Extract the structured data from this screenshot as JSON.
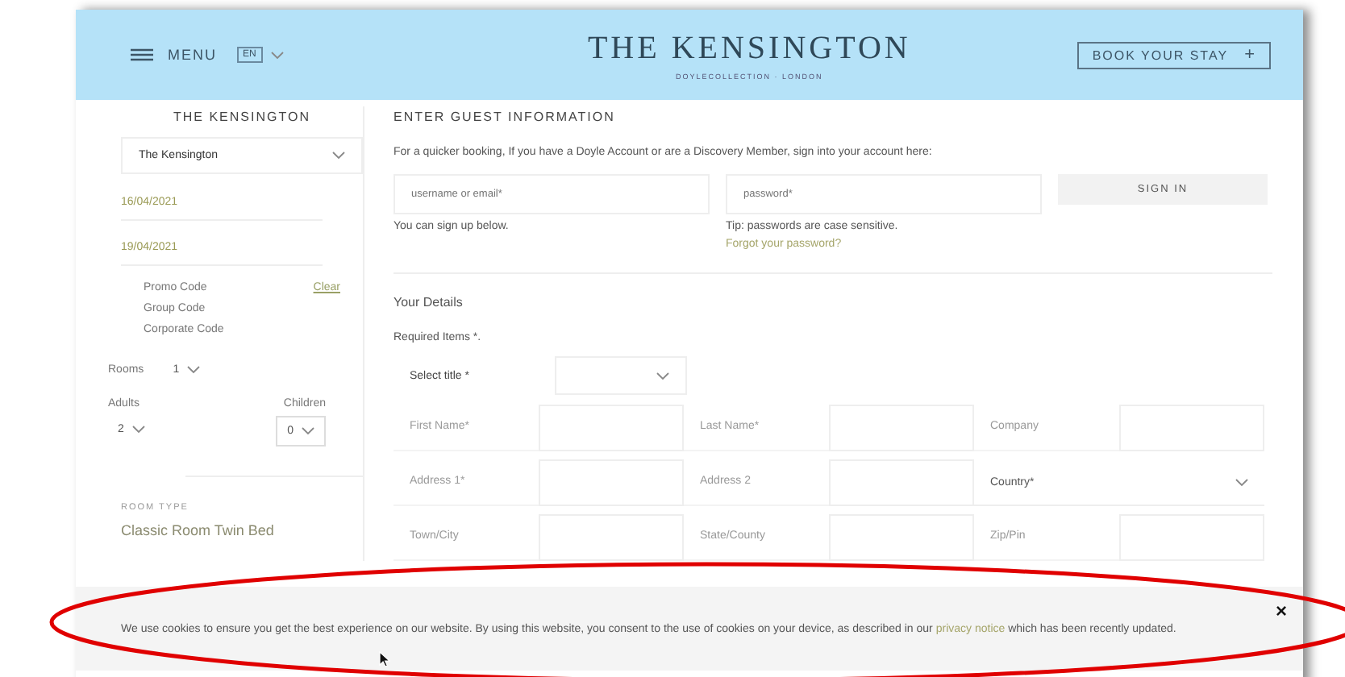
{
  "header": {
    "menu_label": "MENU",
    "language": "EN",
    "logo_title": "THE KENSINGTON",
    "logo_subtitle": "DOYLECOLLECTION · LONDON",
    "book_button": "BOOK YOUR STAY",
    "book_icon": "+"
  },
  "sidebar": {
    "title": "THE KENSINGTON",
    "hotel": "The Kensington",
    "arrival": "16/04/2021",
    "departure": "19/04/2021",
    "codes": [
      "Promo Code",
      "Group Code",
      "Corporate Code"
    ],
    "clear_link": "Clear",
    "rooms": {
      "label": "Rooms",
      "value": "1"
    },
    "adults": {
      "label": "Adults",
      "value": "2"
    },
    "children": {
      "label": "Children",
      "value": "0"
    },
    "room_type_label": "ROOM TYPE",
    "room_type": "Classic Room Twin Bed"
  },
  "main": {
    "heading": "ENTER GUEST INFORMATION",
    "intro": "For a quicker booking, If you have a Doyle Account or are a Discovery Member, sign into your account here:",
    "username": {
      "placeholder": "username or email*"
    },
    "password": {
      "placeholder": "password*"
    },
    "sign_in_button": "SIGN IN",
    "signup_note": "You can sign up below.",
    "password_tip": "Tip: passwords are case sensitive.",
    "forgot_link": "Forgot your password?",
    "details_heading": "Your Details",
    "required_note": "Required Items *.",
    "title_select": {
      "label": "Select title *"
    },
    "fields": [
      {
        "label": "First Name*",
        "kind": "input"
      },
      {
        "label": "Last Name*",
        "kind": "input"
      },
      {
        "label": "Company",
        "kind": "input"
      },
      {
        "label": "Address 1*",
        "kind": "input"
      },
      {
        "label": "Address 2",
        "kind": "input"
      },
      {
        "label": "Country*",
        "kind": "select"
      },
      {
        "label": "Town/City",
        "kind": "input"
      },
      {
        "label": "State/County",
        "kind": "input"
      },
      {
        "label": "Zip/Pin",
        "kind": "input"
      }
    ]
  },
  "cookie_banner": {
    "text": "We use cookies to ensure you get the best experience on our website. By using this website, you consent to the use of cookies on your device, as described in our",
    "link": "privacy notice",
    "text_after": "which has been recently updated.",
    "close": "×"
  }
}
